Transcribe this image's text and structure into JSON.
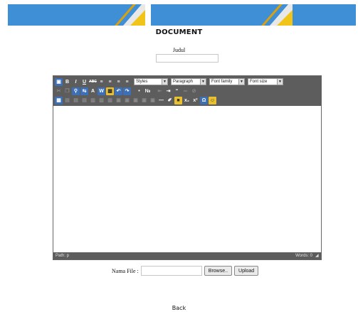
{
  "header": {
    "title": "DOCUMENT"
  },
  "form": {
    "judul_label": "Judul",
    "judul_value": "",
    "file_label": "Nama File :",
    "file_value": "",
    "browse_label": "Browse..",
    "upload_label": "Upload"
  },
  "editor": {
    "row1": {
      "bold": "B",
      "italic": "I",
      "underline": "U",
      "strike": "ABC",
      "styles": "Styles",
      "paragraph": "Paragraph",
      "font_family": "Font family",
      "font_size": "Font size"
    },
    "row3": {
      "subscript": "x₂",
      "superscript": "x²",
      "omega": "Ω"
    },
    "status_path": "Path: p",
    "status_words": "Words: 0"
  },
  "footer": {
    "back_label": "Back"
  },
  "colors": {
    "banner": "#3e8fd6",
    "toolbar": "#5d5d5d",
    "accent_yellow": "#f0c419"
  }
}
